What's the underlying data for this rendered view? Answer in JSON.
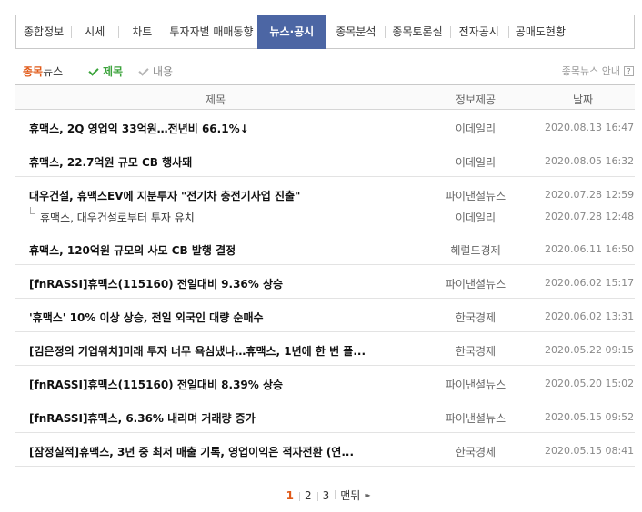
{
  "tabs": [
    {
      "label": "종합정보",
      "width": 44
    },
    {
      "label": "시세",
      "width": 33
    },
    {
      "label": "차트",
      "width": 33
    },
    {
      "label": "투자자별 매매동향",
      "width": 96
    },
    {
      "label": "뉴스·공시",
      "width": 67,
      "active": true
    },
    {
      "label": "종목분석",
      "width": 48
    },
    {
      "label": "종목토론실",
      "width": 56
    },
    {
      "label": "전자공시",
      "width": 48
    },
    {
      "label": "공매도현황",
      "width": 56
    }
  ],
  "sub": {
    "title_accent": "종목",
    "title_rest": "뉴스",
    "filter_title": "제목",
    "filter_content": "내용",
    "guide": "종목뉴스 안내",
    "guide_icon": "?"
  },
  "columns": {
    "title": "제목",
    "source": "정보제공",
    "date": "날짜"
  },
  "rows": [
    {
      "title": "휴맥스, 2Q 영업익 33억원…전년비 66.1%↓",
      "source": "이데일리",
      "date": "2020.08.13 16:47"
    },
    {
      "title": "휴맥스, 22.7억원 규모 CB 행사돼",
      "source": "이데일리",
      "date": "2020.08.05 16:32"
    },
    {
      "title": "대우건설, 휴맥스EV에 지분투자 \"전기차 충전기사업 진출\"",
      "source": "파이낸셜뉴스",
      "date": "2020.07.28 12:59",
      "related": {
        "title": "휴맥스, 대우건설로부터 투자 유치",
        "source": "이데일리",
        "date": "2020.07.28 12:48"
      }
    },
    {
      "title": "휴맥스, 120억원 규모의 사모 CB 발행 결정",
      "source": "헤럴드경제",
      "date": "2020.06.11 16:50"
    },
    {
      "title": "[fnRASSI]휴맥스(115160) 전일대비 9.36% 상승",
      "source": "파이낸셜뉴스",
      "date": "2020.06.02 15:17"
    },
    {
      "title": "'휴맥스' 10% 이상 상승, 전일 외국인 대량 순매수",
      "source": "한국경제",
      "date": "2020.06.02 13:31"
    },
    {
      "title": "[김은정의 기업워치]미래 투자 너무 욕심냈나…휴맥스, 1년에 한 번 폴...",
      "source": "한국경제",
      "date": "2020.05.22 09:15"
    },
    {
      "title": "[fnRASSI]휴맥스(115160) 전일대비 8.39% 상승",
      "source": "파이낸셜뉴스",
      "date": "2020.05.20 15:02"
    },
    {
      "title": "[fnRASSI]휴맥스, 6.36% 내리며 거래량 증가",
      "source": "파이낸셜뉴스",
      "date": "2020.05.15 09:52"
    },
    {
      "title": "[잠정실적]휴맥스, 3년 중 최저 매출 기록, 영업이익은 적자전환 (연...",
      "source": "한국경제",
      "date": "2020.05.15 08:41"
    }
  ],
  "pager": {
    "pages": [
      "1",
      "2",
      "3"
    ],
    "current": "1",
    "last_label": "맨뒤",
    "last_icon": "▸▸"
  },
  "colors": {
    "active_tab": "#4c66a4",
    "accent": "#e05a19",
    "check_on": "#3ba33b"
  }
}
